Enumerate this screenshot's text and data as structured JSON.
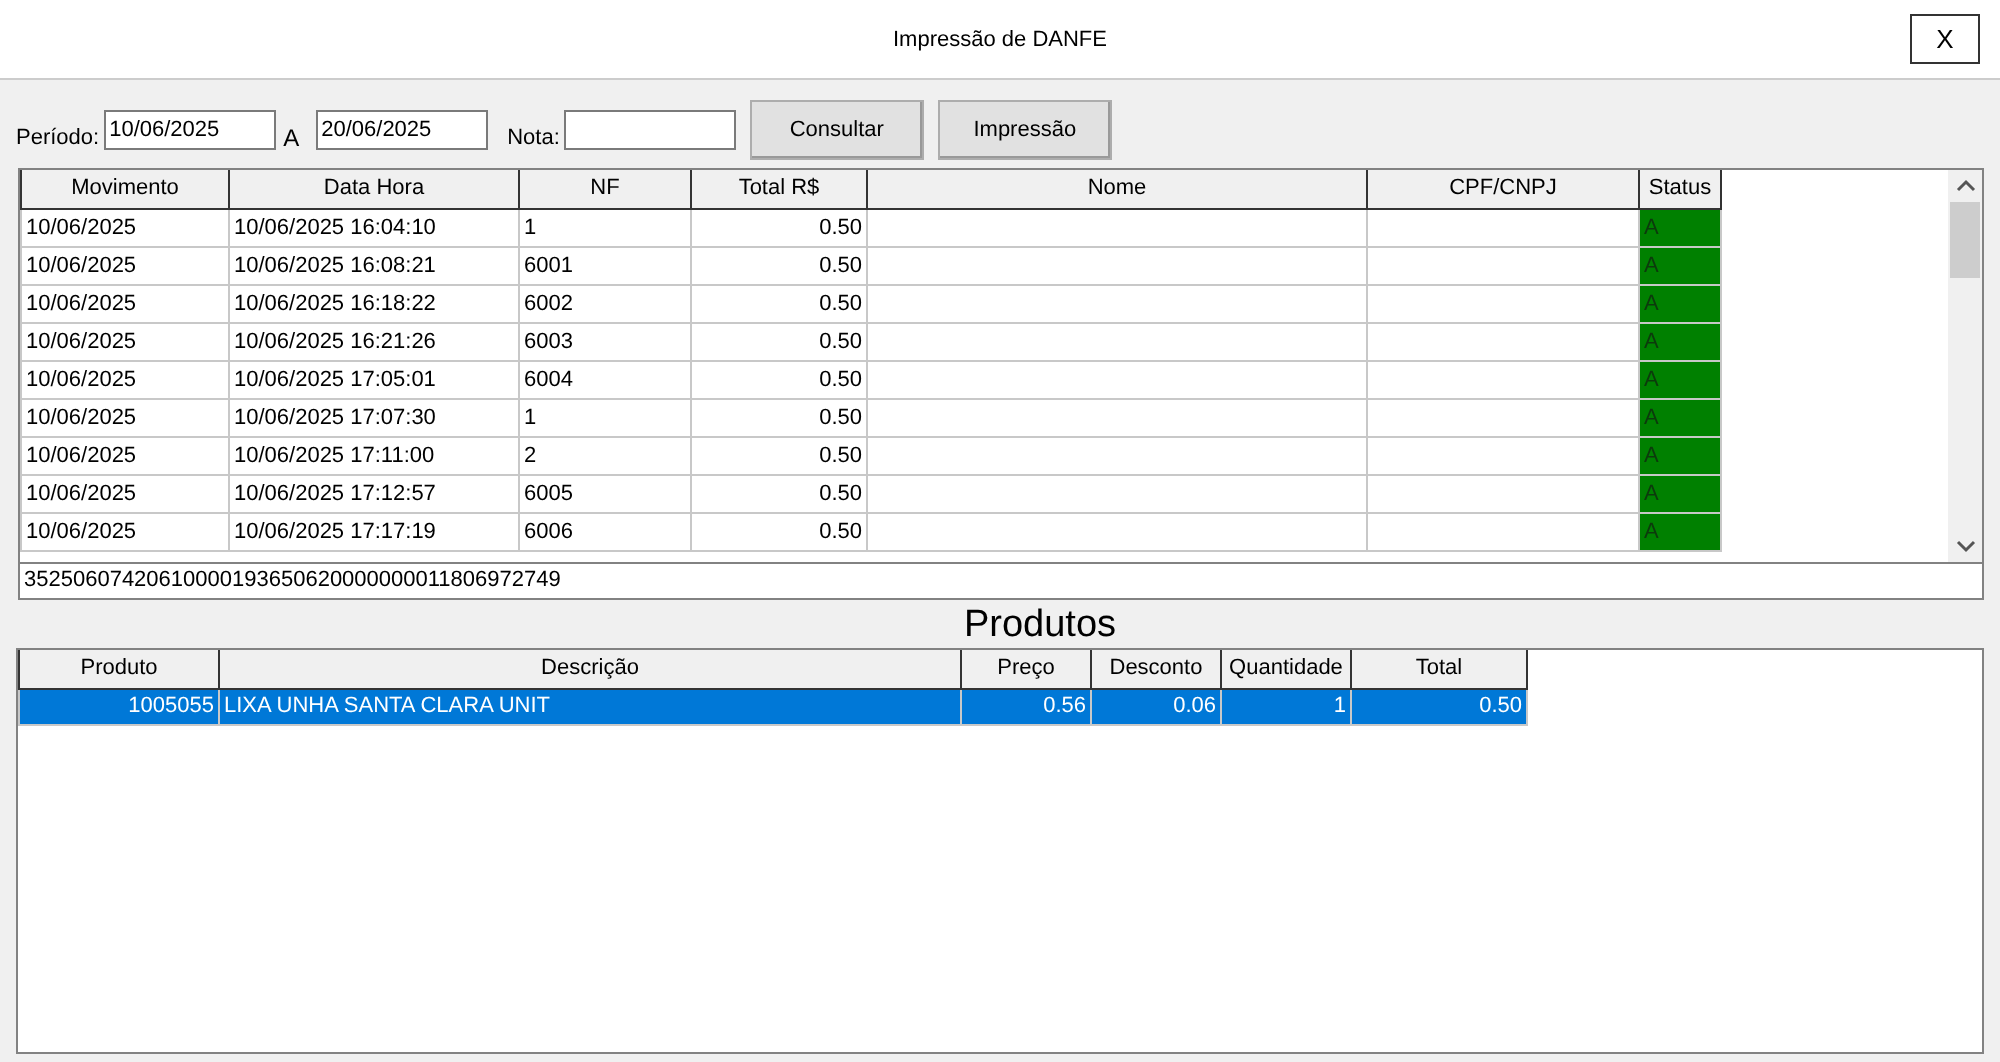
{
  "window": {
    "title": "Impressão de DANFE",
    "close": "X"
  },
  "filters": {
    "period_label": "Período:",
    "date_from": "10/06/2025",
    "separator": "A",
    "date_to": "20/06/2025",
    "note_label": "Nota:",
    "buttons": [
      "Consultar",
      "Impressão"
    ]
  },
  "notes_table": {
    "columns": [
      "Movimento",
      "Data Hora",
      "NF",
      "Total R$",
      "Nome",
      "CPF/CNPJ",
      "Status"
    ],
    "rows": [
      {
        "movimento": "10/06/2025",
        "data_hora": "10/06/2025 16:04:10",
        "nf": "1",
        "total": "0.50",
        "status": "A",
        "color": "#008000"
      },
      {
        "movimento": "10/06/2025",
        "data_hora": "10/06/2025 16:08:21",
        "nf": "6001",
        "total": "0.50",
        "status": "A",
        "color": "#008000"
      },
      {
        "movimento": "10/06/2025",
        "data_hora": "10/06/2025 16:18:22",
        "nf": "6002",
        "total": "0.50",
        "status": "A",
        "color": "#008000"
      },
      {
        "movimento": "10/06/2025",
        "data_hora": "10/06/2025 16:21:26",
        "nf": "6003",
        "total": "0.50",
        "status": "A",
        "color": "#008000"
      },
      {
        "movimento": "10/06/2025",
        "data_hora": "10/06/2025 17:05:01",
        "nf": "6004",
        "total": "0.50",
        "status": "A",
        "color": "#008000"
      },
      {
        "movimento": "10/06/2025",
        "data_hora": "10/06/2025 17:07:30",
        "nf": "1",
        "total": "0.50",
        "status": "A",
        "color": "#008000"
      },
      {
        "movimento": "10/06/2025",
        "data_hora": "10/06/2025 17:11:00",
        "nf": "2",
        "total": "0.50",
        "status": "A",
        "color": "#008000"
      },
      {
        "movimento": "10/06/2025",
        "data_hora": "10/06/2025 17:12:57",
        "nf": "6005",
        "total": "0.50",
        "status": "A",
        "color": "#008000"
      },
      {
        "movimento": "10/06/2025",
        "data_hora": "10/06/2025 17:17:19",
        "nf": "6006",
        "total": "0.50",
        "status": "A",
        "color": "#008000"
      }
    ],
    "access_key": "35250607420610000193650620000000011806972749"
  },
  "products": {
    "title": "Produtos",
    "columns": [
      "Produto",
      "Descrição",
      "Preço",
      "Desconto",
      "Quantidade",
      "Total"
    ],
    "rows": [
      {
        "produto": "1005055",
        "descricao": "LIXA UNHA SANTA CLARA UNIT",
        "preco": "0.56",
        "desconto": "0.06",
        "quantidade": "1",
        "total": "0.50",
        "selected": true
      }
    ]
  }
}
